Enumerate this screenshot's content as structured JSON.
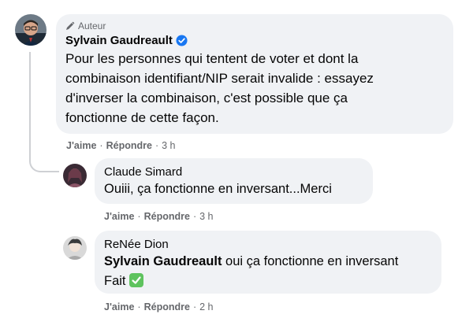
{
  "main_comment": {
    "badge": "Auteur",
    "author": "Sylvain Gaudreault",
    "lines": [
      "Pour les personnes qui tentent de voter et dont la",
      "combinaison identifiant/NIP serait invalide : essayez",
      "d'inverser la combinaison, c'est possible que ça",
      "fonctionne de cette façon."
    ],
    "like": "J'aime",
    "reply": "Répondre",
    "time": "3 h"
  },
  "reply1": {
    "author": "Claude Simard",
    "text": "Ouiii, ça fonctionne en inversant...Merci",
    "like": "J'aime",
    "reply": "Répondre",
    "time": "3 h"
  },
  "reply2": {
    "author": "ReNée Dion",
    "mention": "Sylvain Gaudreault",
    "text_rest": " oui ça fonctionne en inversant",
    "text_line2": "Fait",
    "like": "J'aime",
    "reply": "Répondre",
    "time": "2 h"
  },
  "separator": "·",
  "colors": {
    "bubble": "#f0f2f5",
    "verified": "#1877f2",
    "meta": "#65676b",
    "check": "#5ec35e"
  }
}
